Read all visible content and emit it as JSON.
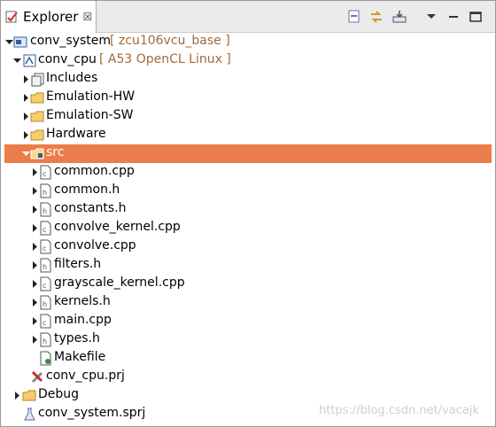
{
  "panel": {
    "tab_label": "Explorer",
    "tab_close": "☒",
    "toolbar": [
      "collapse-all-icon",
      "link-editor-icon",
      "import-icon",
      "view-menu-icon",
      "minimize-icon",
      "maximize-icon"
    ]
  },
  "tree": {
    "system": {
      "name": "conv_system",
      "decoration": "[ zcu106vcu_base ]"
    },
    "project": {
      "name": "conv_cpu",
      "decoration": "[ A53 OpenCL Linux ]"
    },
    "folders": [
      "Includes",
      "Emulation-HW",
      "Emulation-SW",
      "Hardware"
    ],
    "src": "src",
    "files": [
      "common.cpp",
      "common.h",
      "constants.h",
      "convolve_kernel.cpp",
      "convolve.cpp",
      "filters.h",
      "grayscale_kernel.cpp",
      "kernels.h",
      "main.cpp",
      "types.h"
    ],
    "makefile": "Makefile",
    "project_file": "conv_cpu.prj",
    "debug": "Debug",
    "system_file": "conv_system.sprj"
  },
  "watermark": "https://blog.csdn.net/vacajk",
  "colors": {
    "selection": "#ec7d4a",
    "decoration": "#a26a3a"
  }
}
